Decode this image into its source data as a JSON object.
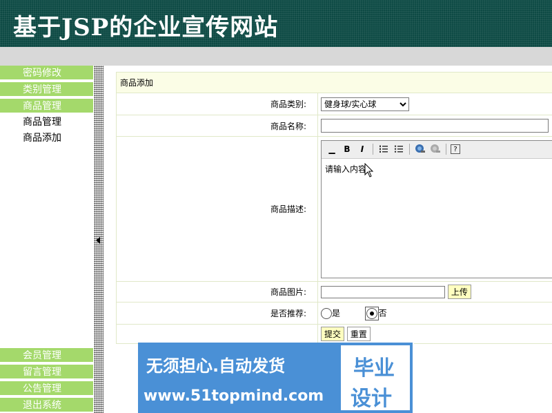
{
  "header": {
    "title": "基于JSP的企业宣传网站"
  },
  "sidebar": {
    "top_menus": [
      {
        "label": "密码修改"
      },
      {
        "label": "类别管理"
      },
      {
        "label": "商品管理"
      }
    ],
    "sub_items": [
      {
        "label": "商品管理"
      },
      {
        "label": "商品添加"
      }
    ],
    "bottom_menus": [
      {
        "label": "会员管理"
      },
      {
        "label": "留言管理"
      },
      {
        "label": "公告管理"
      },
      {
        "label": "退出系统"
      }
    ]
  },
  "form": {
    "caption": "商品添加",
    "category_label": "商品类别:",
    "category_value": "健身球/实心球",
    "name_label": "商品名称:",
    "name_value": "",
    "desc_label": "商品描述:",
    "desc_value": "请输入内容",
    "image_label": "商品图片:",
    "image_value": "",
    "upload_button": "上传",
    "recommend_label": "是否推荐:",
    "recommend_yes": "是",
    "recommend_no": "否",
    "recommend_selected": "否",
    "submit_button": "提交",
    "reset_button": "重置"
  },
  "editor_toolbar": {
    "bold": "B",
    "italic": "I",
    "help": "?"
  },
  "watermark": {
    "line1": "无须担心.自动发货",
    "line2": "www.51topmind.com",
    "right1": "毕业",
    "right2": "设计"
  },
  "colors": {
    "header_bg": "#0d4a44",
    "menu_green": "#a4d96b",
    "watermark_blue": "#4a90d6"
  }
}
